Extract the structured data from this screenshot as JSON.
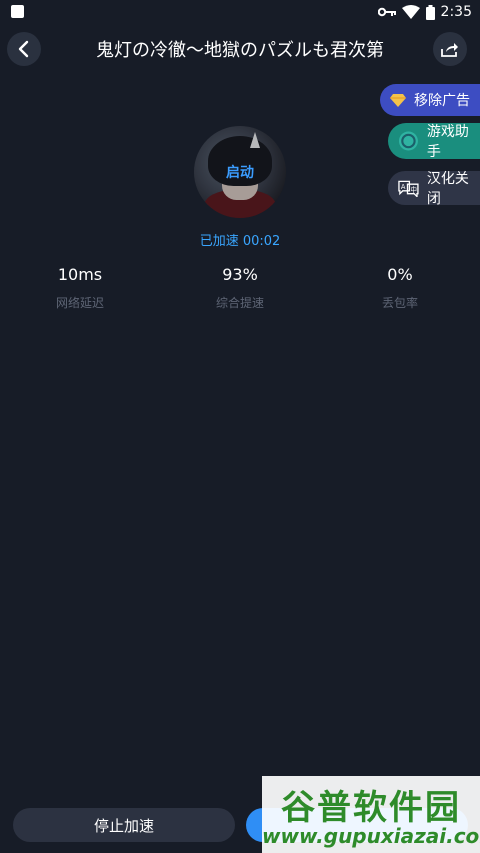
{
  "status_bar": {
    "time": "2:35"
  },
  "header": {
    "title": "鬼灯の冷徹〜地獄のパズルも君次第"
  },
  "side_buttons": {
    "remove_ad": "移除广告",
    "game_assistant": "游戏助手",
    "localization_off": "汉化关闭"
  },
  "game": {
    "start_label": "启动",
    "accel_status": "已加速 00:02"
  },
  "stats": [
    {
      "value": "10ms",
      "label": "网络延迟"
    },
    {
      "value": "93%",
      "label": "综合提速"
    },
    {
      "value": "0%",
      "label": "丢包率"
    }
  ],
  "bottom": {
    "stop_label": "停止加速"
  },
  "watermark": {
    "brand": "谷普软件园",
    "url": "www.gupuxiazai.com"
  }
}
